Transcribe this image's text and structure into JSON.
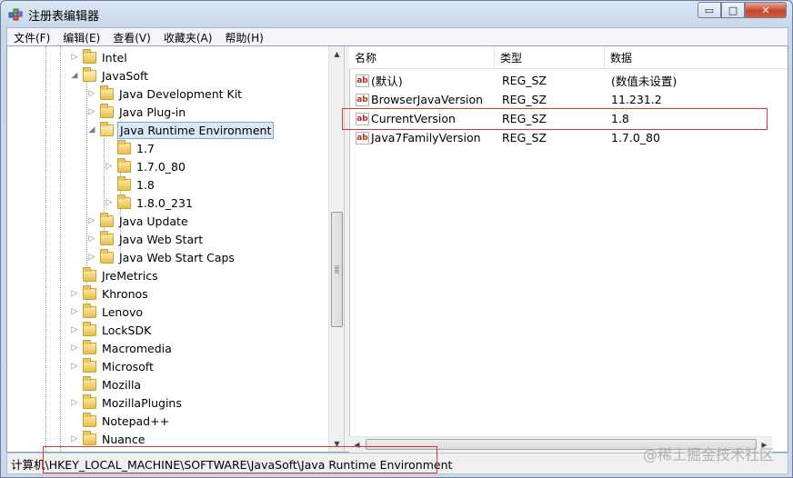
{
  "window": {
    "title": "注册表编辑器",
    "caption_buttons": {
      "minimize": "▭",
      "maximize": "□",
      "close": "✕"
    }
  },
  "menu": [
    "文件(F)",
    "编辑(E)",
    "查看(V)",
    "收藏夹(A)",
    "帮助(H)"
  ],
  "tree": [
    {
      "label": "Intel",
      "level": 0,
      "expander": "▷"
    },
    {
      "label": "JavaSoft",
      "level": 0,
      "expander": "◢",
      "open": true
    },
    {
      "label": "Java Development Kit",
      "level": 1,
      "expander": "▷"
    },
    {
      "label": "Java Plug-in",
      "level": 1,
      "expander": "▷"
    },
    {
      "label": "Java Runtime Environment",
      "level": 1,
      "expander": "◢",
      "open": true,
      "selected": true
    },
    {
      "label": "1.7",
      "level": 2,
      "expander": ""
    },
    {
      "label": "1.7.0_80",
      "level": 2,
      "expander": "▷"
    },
    {
      "label": "1.8",
      "level": 2,
      "expander": ""
    },
    {
      "label": "1.8.0_231",
      "level": 2,
      "expander": "▷"
    },
    {
      "label": "Java Update",
      "level": 1,
      "expander": "▷"
    },
    {
      "label": "Java Web Start",
      "level": 1,
      "expander": "▷"
    },
    {
      "label": "Java Web Start Caps",
      "level": 1,
      "expander": "▷"
    },
    {
      "label": "JreMetrics",
      "level": 0,
      "expander": ""
    },
    {
      "label": "Khronos",
      "level": 0,
      "expander": "▷"
    },
    {
      "label": "Lenovo",
      "level": 0,
      "expander": "▷"
    },
    {
      "label": "LockSDK",
      "level": 0,
      "expander": "▷"
    },
    {
      "label": "Macromedia",
      "level": 0,
      "expander": "▷"
    },
    {
      "label": "Microsoft",
      "level": 0,
      "expander": "▷"
    },
    {
      "label": "Mozilla",
      "level": 0,
      "expander": ""
    },
    {
      "label": "MozillaPlugins",
      "level": 0,
      "expander": "▷"
    },
    {
      "label": "Notepad++",
      "level": 0,
      "expander": ""
    },
    {
      "label": "Nuance",
      "level": 0,
      "expander": "▷"
    }
  ],
  "list": {
    "columns": [
      "名称",
      "类型",
      "数据"
    ],
    "rows": [
      {
        "name": "(默认)",
        "type": "REG_SZ",
        "data": "(数值未设置)"
      },
      {
        "name": "BrowserJavaVersion",
        "type": "REG_SZ",
        "data": "11.231.2"
      },
      {
        "name": "CurrentVersion",
        "type": "REG_SZ",
        "data": "1.8",
        "highlighted": true
      },
      {
        "name": "Java7FamilyVersion",
        "type": "REG_SZ",
        "data": "1.7.0_80"
      }
    ],
    "icon_text": "ab"
  },
  "status": {
    "path": "计算机\\HKEY_LOCAL_MACHINE\\SOFTWARE\\JavaSoft\\Java Runtime Environment"
  },
  "watermark": "@稀土掘金技术社区",
  "colors": {
    "highlight": "#d9363a",
    "selection": "#d8e8f7"
  }
}
